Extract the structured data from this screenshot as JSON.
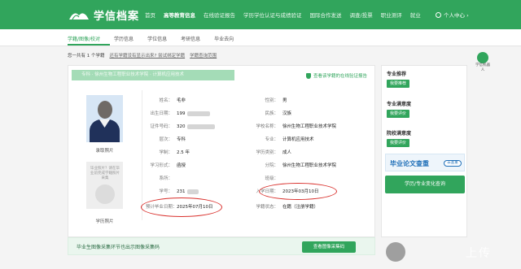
{
  "header": {
    "logo_text": "学信档案",
    "nav": [
      "首页",
      "高等教育信息",
      "在线验证报告",
      "学历学位认证与成绩验证",
      "国际合作发送",
      "调查/投票",
      "职业测评",
      "就业"
    ],
    "nav_active": 1,
    "user_label": "个人中心 ›"
  },
  "subnav": {
    "items": [
      "学籍/图像/校对",
      "学历信息",
      "学位信息",
      "考研信息",
      "毕业去向"
    ],
    "active": 0
  },
  "breadcrumb": {
    "count_text": "您一共有 1 个学籍",
    "question": "还有学籍没有显示出来? 尝试绑定学籍",
    "help": "学籍查询范围"
  },
  "side_badge": {
    "label": "学信机器人"
  },
  "main": {
    "banner": "专科 · 徐州生物工程职业技术学院 · 计算机应用技术",
    "verify_text": "查看该学籍的在线验证报告",
    "photo1_label": "录取照片",
    "photo2_note": "毕业照片？请在毕业前完成学籍照片采集",
    "photo2_label": "学历照片",
    "fields": {
      "name_label": "姓名：",
      "name_value": "毛非",
      "gender_label": "性别：",
      "gender_value": "男",
      "birth_label": "出生日期：",
      "birth_value": "199",
      "ethnic_label": "民族：",
      "ethnic_value": "汉族",
      "id_label": "证件号码：",
      "id_value": "320",
      "school_label": "学校名称：",
      "school_value": "徐州生物工程职业技术学院",
      "level_label": "层次：",
      "level_value": "专科",
      "major_label": "专业：",
      "major_value": "计算机应用技术",
      "duration_label": "学制：",
      "duration_value": "2.5 年",
      "type_label": "学历类别：",
      "type_value": "成人",
      "form_label": "学习形式：",
      "form_value": "函授",
      "branch_label": "分院：",
      "branch_value": "徐州生物工程职业技术学院",
      "dept_label": "系所：",
      "dept_value": "",
      "class_label": "班级：",
      "class_value": "",
      "sid_label": "学号：",
      "sid_value": "231",
      "enroll_label": "入学日期：",
      "enroll_value": "2023年03月10日",
      "grad_label": "预计毕业日期：",
      "grad_value": "2025年07月10日",
      "status_label": "学籍状态：",
      "status_value": "在籍（注册学籍）"
    }
  },
  "footer": {
    "text": "毕业生图像采集环节也出示图像采集码",
    "button": "查看图像采集码"
  },
  "sidebar": {
    "recommend_title": "专业推荐",
    "recommend_btn": "我要推荐",
    "satisfaction_title": "专业满意度",
    "satisfaction_btn": "我要评价",
    "school_title": "院校满意度",
    "school_btn": "我要评价",
    "ad_text": "毕业论文查重",
    "ad_pill": "去查重",
    "green_btn": "学历/专业变化查询"
  },
  "watermark": {
    "text": "上传"
  },
  "colors": {
    "brand_green": "#31a55c",
    "highlight_red": "#d9302c"
  }
}
